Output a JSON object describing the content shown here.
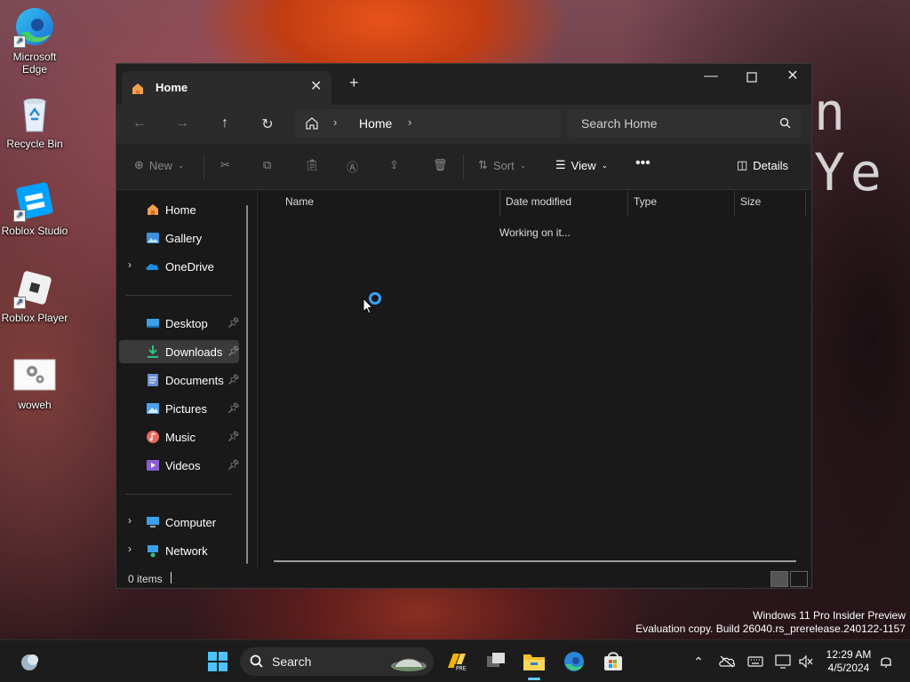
{
  "desktop": {
    "wallpaper_text": "n Ye",
    "icons": [
      {
        "label": "Microsoft Edge",
        "icon": "edge-icon"
      },
      {
        "label": "Recycle Bin",
        "icon": "recycle-bin-icon"
      },
      {
        "label": "Roblox Studio",
        "icon": "roblox-studio-icon"
      },
      {
        "label": "Roblox Player",
        "icon": "roblox-player-icon"
      },
      {
        "label": "woweh",
        "icon": "settings-file-icon"
      }
    ]
  },
  "window": {
    "tab": {
      "label": "Home"
    },
    "address": {
      "current": "Home"
    },
    "search": {
      "placeholder": "Search Home"
    },
    "toolbar": {
      "new_label": "New",
      "sort_label": "Sort",
      "view_label": "View",
      "details_label": "Details"
    },
    "sidebar": {
      "top": [
        {
          "label": "Home",
          "icon": "home-icon"
        },
        {
          "label": "Gallery",
          "icon": "gallery-icon"
        },
        {
          "label": "OneDrive",
          "icon": "onedrive-icon"
        }
      ],
      "quick": [
        {
          "label": "Desktop",
          "icon": "desktop-icon"
        },
        {
          "label": "Downloads",
          "icon": "downloads-icon"
        },
        {
          "label": "Documents",
          "icon": "documents-icon"
        },
        {
          "label": "Pictures",
          "icon": "pictures-icon"
        },
        {
          "label": "Music",
          "icon": "music-icon"
        },
        {
          "label": "Videos",
          "icon": "videos-icon"
        }
      ],
      "bottom": [
        {
          "label": "Computer",
          "icon": "computer-icon"
        },
        {
          "label": "Network",
          "icon": "network-icon"
        }
      ],
      "selected": "Downloads"
    },
    "columns": [
      "Name",
      "Date modified",
      "Type",
      "Size"
    ],
    "content_status": "Working on it...",
    "status_bar": {
      "items_text": "0 items"
    }
  },
  "watermark": {
    "line1": "Windows 11 Pro Insider Preview",
    "line2": "Evaluation copy. Build 26040.rs_prerelease.240122-1157"
  },
  "taskbar": {
    "search_label": "Search",
    "clock_time": "12:29 AM",
    "clock_date": "4/5/2024"
  },
  "colors": {
    "accent": "#60cdff",
    "window_bg": "#191919",
    "taskbar_bg": "#1c1c1c"
  }
}
